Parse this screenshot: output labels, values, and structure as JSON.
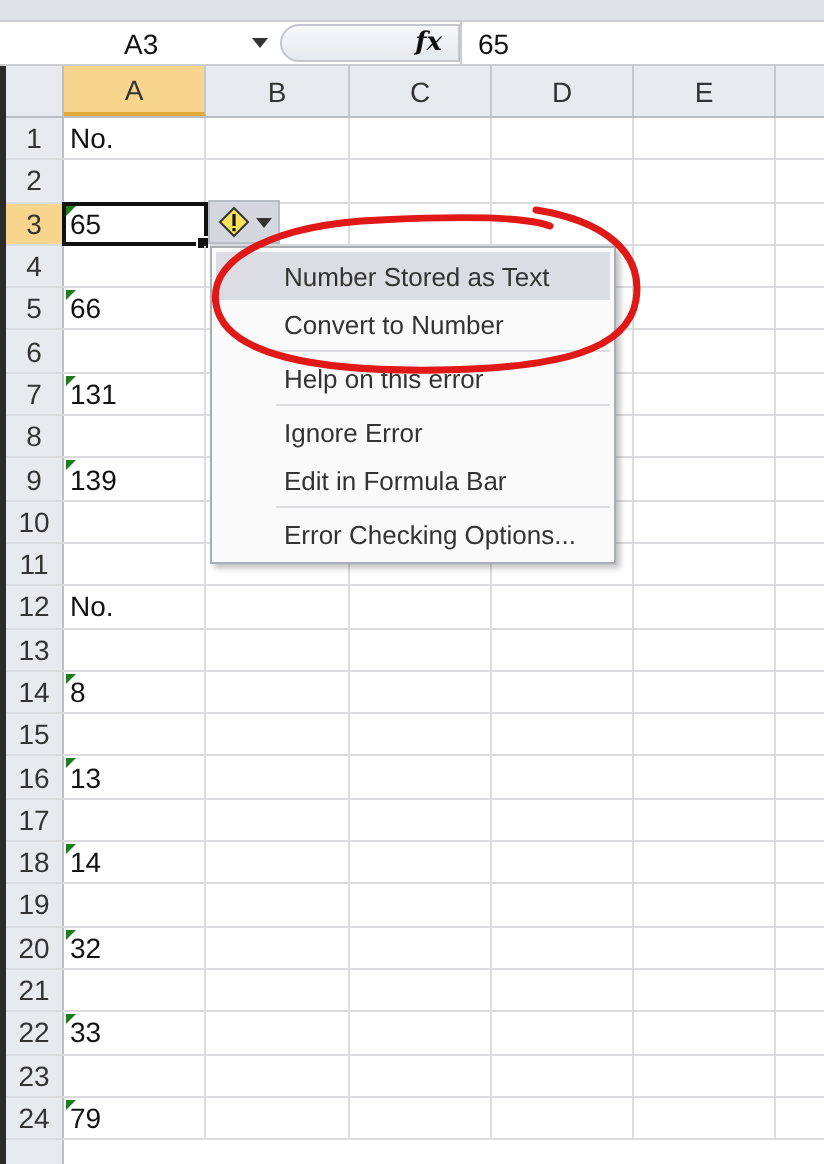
{
  "formula_bar": {
    "name_box": "A3",
    "function_label": "fx",
    "formula": "65"
  },
  "columns": [
    {
      "label": "A",
      "selected": true
    },
    {
      "label": "B",
      "selected": false
    },
    {
      "label": "C",
      "selected": false
    },
    {
      "label": "D",
      "selected": false
    },
    {
      "label": "E",
      "selected": false
    }
  ],
  "rows": [
    {
      "header": "1",
      "value": "No.",
      "flagged": false,
      "selected": false
    },
    {
      "header": "2",
      "value": "",
      "flagged": false,
      "selected": false
    },
    {
      "header": "3",
      "value": "65",
      "flagged": true,
      "selected": true
    },
    {
      "header": "4",
      "value": "",
      "flagged": false,
      "selected": false
    },
    {
      "header": "5",
      "value": "66",
      "flagged": true,
      "selected": false
    },
    {
      "header": "6",
      "value": "",
      "flagged": false,
      "selected": false
    },
    {
      "header": "7",
      "value": "131",
      "flagged": true,
      "selected": false
    },
    {
      "header": "8",
      "value": "",
      "flagged": false,
      "selected": false
    },
    {
      "header": "9",
      "value": "139",
      "flagged": true,
      "selected": false
    },
    {
      "header": "10",
      "value": "",
      "flagged": false,
      "selected": false
    },
    {
      "header": "11",
      "value": "",
      "flagged": false,
      "selected": false
    },
    {
      "header": "12",
      "value": "No.",
      "flagged": false,
      "selected": false
    },
    {
      "header": "13",
      "value": "",
      "flagged": false,
      "selected": false
    },
    {
      "header": "14",
      "value": "8",
      "flagged": true,
      "selected": false
    },
    {
      "header": "15",
      "value": "",
      "flagged": false,
      "selected": false
    },
    {
      "header": "16",
      "value": "13",
      "flagged": true,
      "selected": false
    },
    {
      "header": "17",
      "value": "",
      "flagged": false,
      "selected": false
    },
    {
      "header": "18",
      "value": "14",
      "flagged": true,
      "selected": false
    },
    {
      "header": "19",
      "value": "",
      "flagged": false,
      "selected": false
    },
    {
      "header": "20",
      "value": "32",
      "flagged": true,
      "selected": false
    },
    {
      "header": "21",
      "value": "",
      "flagged": false,
      "selected": false
    },
    {
      "header": "22",
      "value": "33",
      "flagged": true,
      "selected": false
    },
    {
      "header": "23",
      "value": "",
      "flagged": false,
      "selected": false
    },
    {
      "header": "24",
      "value": "79",
      "flagged": true,
      "selected": false
    }
  ],
  "error_menu": {
    "items": [
      {
        "kind": "header",
        "label": "Number Stored as Text"
      },
      {
        "kind": "item",
        "label": "Convert to Number"
      },
      {
        "kind": "separator"
      },
      {
        "kind": "item",
        "label": "Help on this error"
      },
      {
        "kind": "separator"
      },
      {
        "kind": "item",
        "label": "Ignore Error"
      },
      {
        "kind": "item",
        "label": "Edit in Formula Bar"
      },
      {
        "kind": "separator"
      },
      {
        "kind": "item",
        "label": "Error Checking Options..."
      }
    ]
  }
}
